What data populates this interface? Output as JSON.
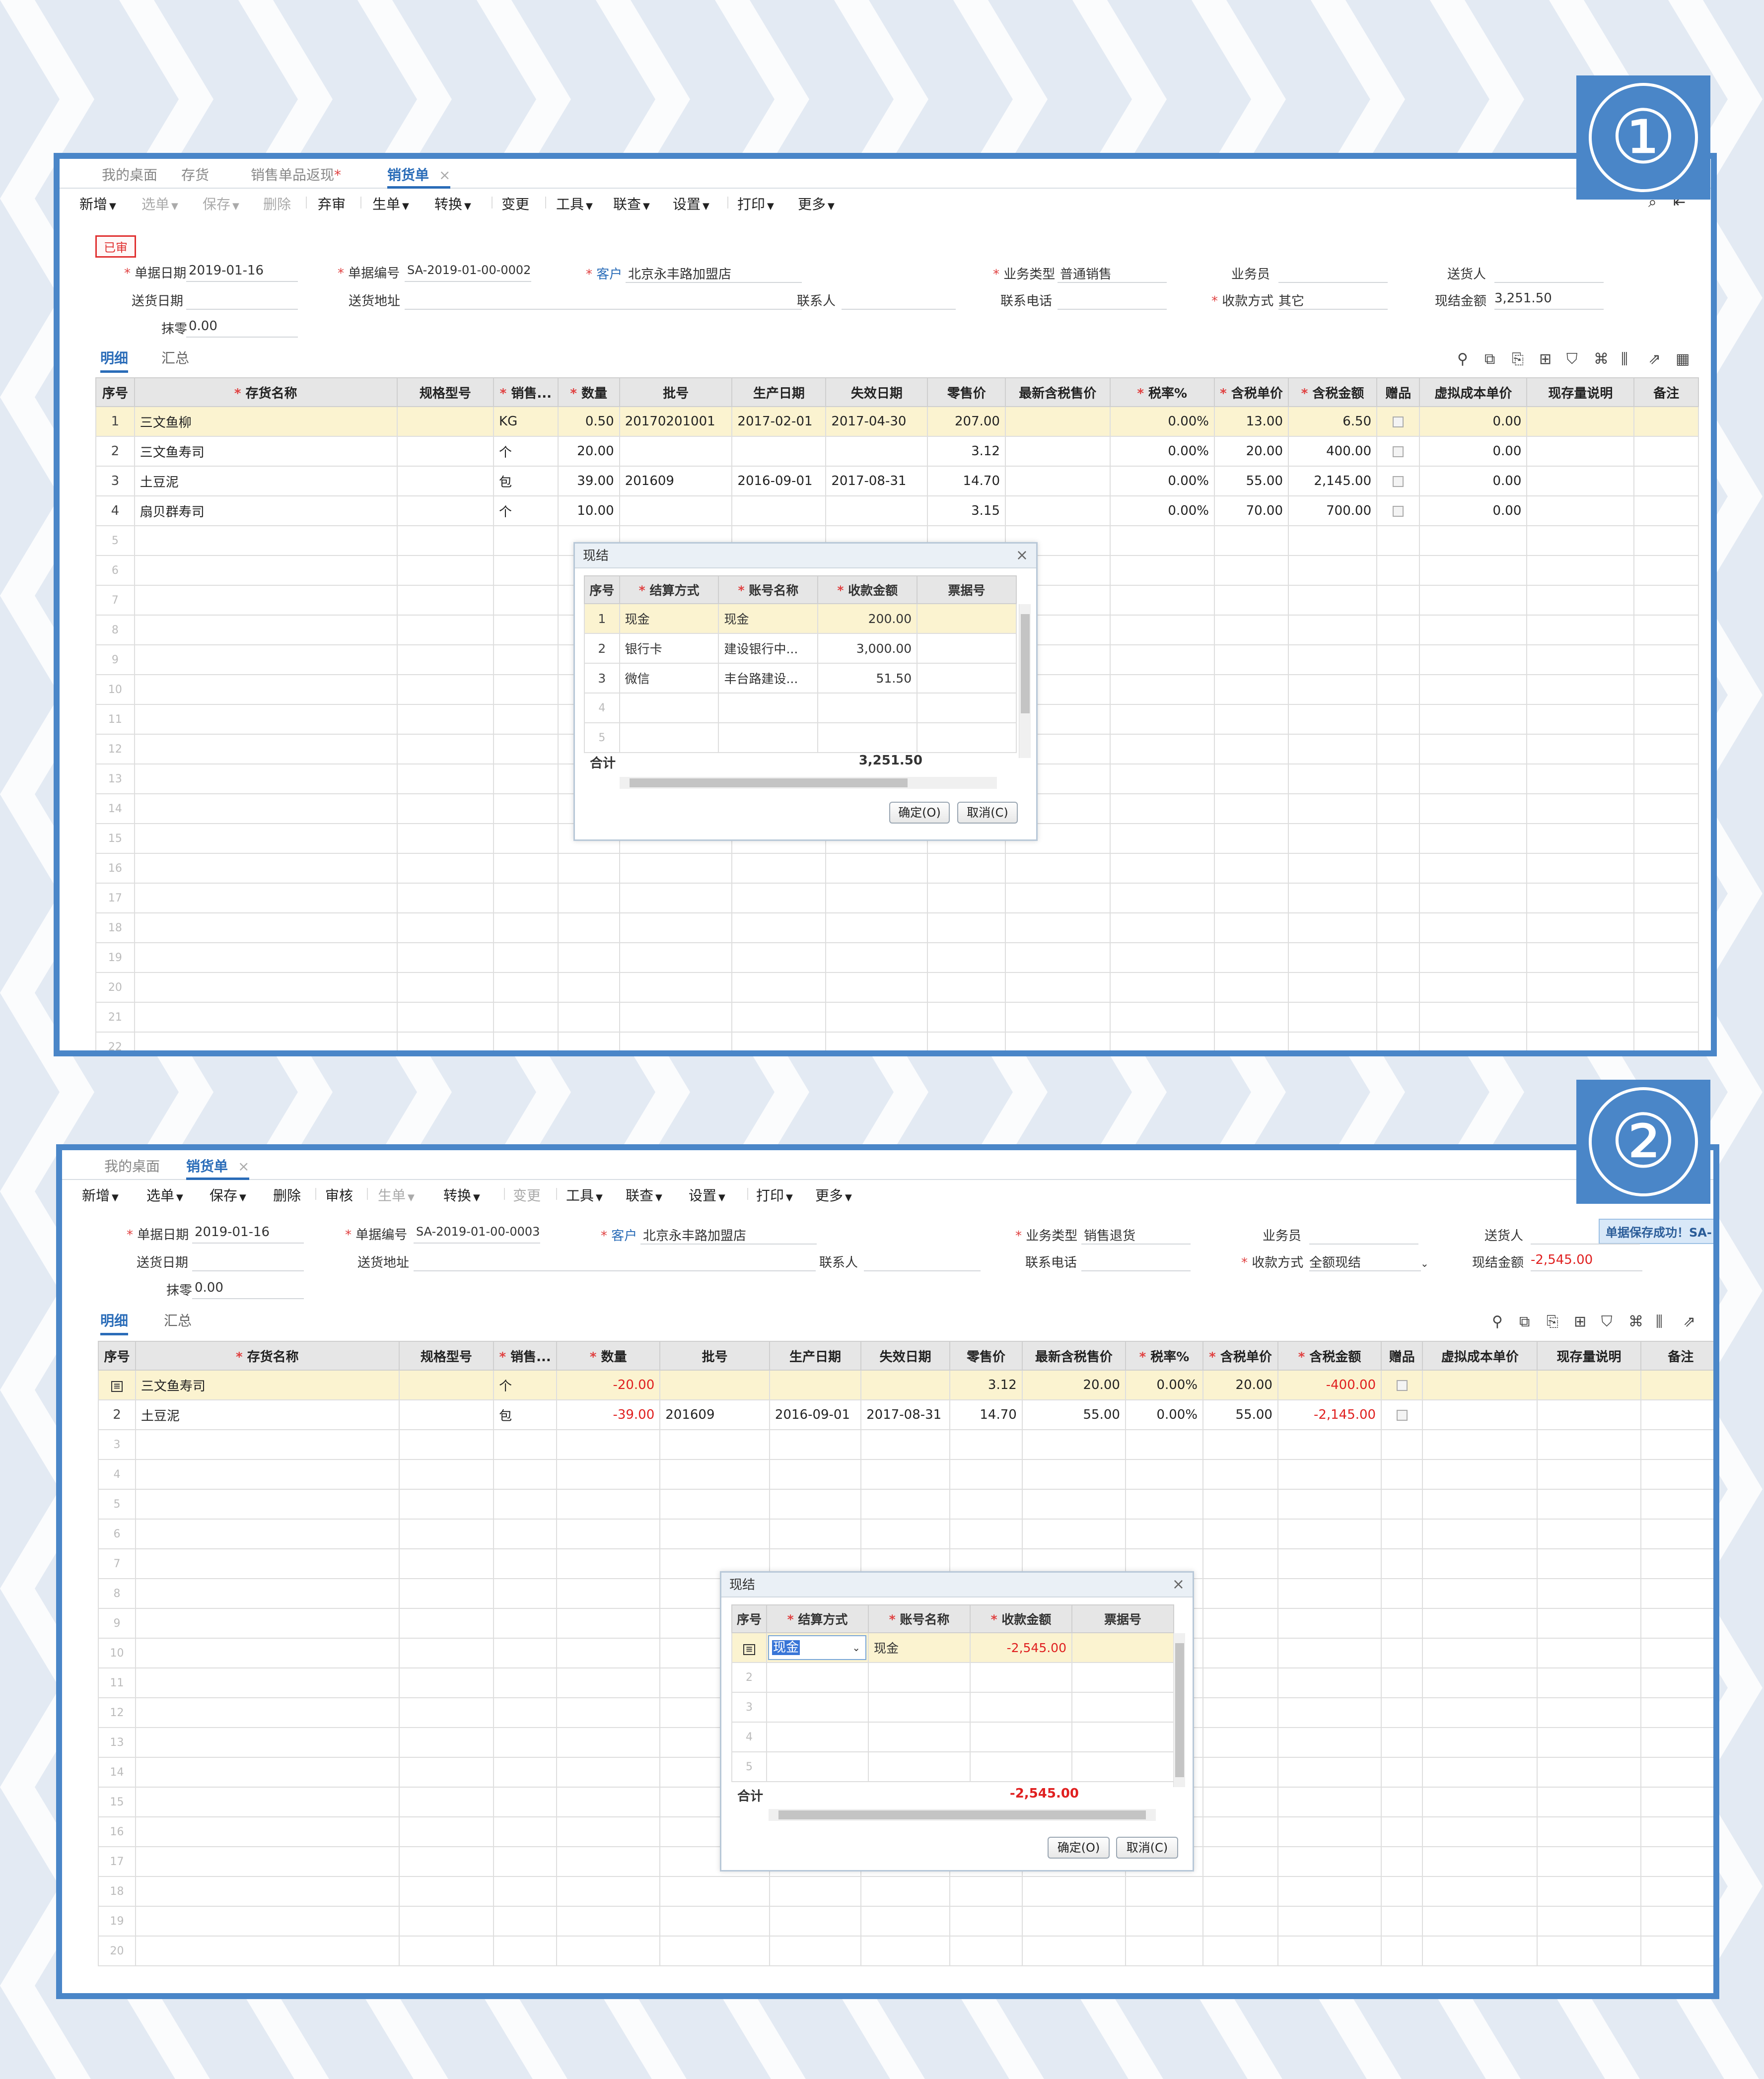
{
  "badges": {
    "one": "①",
    "two": "②"
  },
  "panel1": {
    "tabs": [
      {
        "label": "我的桌面"
      },
      {
        "label": "存货"
      },
      {
        "label": "销售单品返现",
        "star": "*"
      },
      {
        "label": "销货单",
        "close": "×"
      }
    ],
    "toolbar": [
      "新增",
      "选单",
      "保存",
      "删除",
      "弃审",
      "生单",
      "转换",
      "变更",
      "工具",
      "联查",
      "设置",
      "打印",
      "更多"
    ],
    "status_stamp": "已审",
    "header": {
      "doc_date_label": "单据日期",
      "doc_date": "2019-01-16",
      "doc_no_label": "单据编号",
      "doc_no": "SA-2019-01-00-0002",
      "customer_label": "客户",
      "customer": "北京永丰路加盟店",
      "biz_type_label": "业务类型",
      "biz_type": "普通销售",
      "salesman_label": "业务员",
      "deliverer_label": "送货人",
      "delivery_date_label": "送货日期",
      "delivery_addr_label": "送货地址",
      "contact_label": "联系人",
      "phone_label": "联系电话",
      "pay_method_label": "收款方式",
      "pay_method": "其它",
      "cash_amount_label": "现结金额",
      "cash_amount": "3,251.50",
      "round_off_label": "抹零",
      "round_off": "0.00"
    },
    "subtabs": [
      "明细",
      "汇总"
    ],
    "columns": [
      "序号",
      "存货名称",
      "规格型号",
      "销售...",
      "数量",
      "批号",
      "生产日期",
      "失效日期",
      "零售价",
      "最新含税售价",
      "税率%",
      "含税单价",
      "含税金额",
      "赠品",
      "虚拟成本单价",
      "现存量说明",
      "备注"
    ],
    "rows": [
      {
        "no": "1",
        "name": "三文鱼柳",
        "unit": "KG",
        "qty": "0.50",
        "batch": "20170201001",
        "mfg": "2017-02-01",
        "exp": "2017-04-30",
        "retail": "207.00",
        "tax_rate": "0.00%",
        "unit_price": "13.00",
        "amount": "6.50",
        "cost": "0.00"
      },
      {
        "no": "2",
        "name": "三文鱼寿司",
        "unit": "个",
        "qty": "20.00",
        "batch": "",
        "mfg": "",
        "exp": "",
        "retail": "3.12",
        "tax_rate": "0.00%",
        "unit_price": "20.00",
        "amount": "400.00",
        "cost": "0.00"
      },
      {
        "no": "3",
        "name": "土豆泥",
        "unit": "包",
        "qty": "39.00",
        "batch": "201609",
        "mfg": "2016-09-01",
        "exp": "2017-08-31",
        "retail": "14.70",
        "tax_rate": "0.00%",
        "unit_price": "55.00",
        "amount": "2,145.00",
        "cost": "0.00"
      },
      {
        "no": "4",
        "name": "扇贝群寿司",
        "unit": "个",
        "qty": "10.00",
        "batch": "",
        "mfg": "",
        "exp": "",
        "retail": "3.15",
        "tax_rate": "0.00%",
        "unit_price": "70.00",
        "amount": "700.00",
        "cost": "0.00"
      }
    ],
    "empty_rows": [
      "5",
      "6",
      "7",
      "8",
      "9",
      "10",
      "11",
      "12",
      "13",
      "14",
      "15",
      "16",
      "17",
      "18",
      "19",
      "20",
      "21",
      "22"
    ],
    "dialog": {
      "title": "现结",
      "close": "×",
      "columns": [
        "序号",
        "结算方式",
        "账号名称",
        "收款金额",
        "票据号"
      ],
      "rows": [
        {
          "no": "1",
          "method": "现金",
          "account": "现金",
          "amount": "200.00"
        },
        {
          "no": "2",
          "method": "银行卡",
          "account": "建设银行中...",
          "amount": "3,000.00"
        },
        {
          "no": "3",
          "method": "微信",
          "account": "丰台路建设...",
          "amount": "51.50"
        }
      ],
      "empty_rows": [
        "4",
        "5"
      ],
      "total_label": "合计",
      "total": "3,251.50",
      "ok": "确定(O)",
      "cancel": "取消(C)"
    }
  },
  "panel2": {
    "tabs": [
      {
        "label": "我的桌面"
      },
      {
        "label": "销货单",
        "close": "×"
      }
    ],
    "toolbar": [
      "新增",
      "选单",
      "保存",
      "删除",
      "审核",
      "生单",
      "转换",
      "变更",
      "工具",
      "联查",
      "设置",
      "打印",
      "更多"
    ],
    "success_msg": "单据保存成功！SA-",
    "header": {
      "doc_date_label": "单据日期",
      "doc_date": "2019-01-16",
      "doc_no_label": "单据编号",
      "doc_no": "SA-2019-01-00-0003",
      "customer_label": "客户",
      "customer": "北京永丰路加盟店",
      "biz_type_label": "业务类型",
      "biz_type": "销售退货",
      "salesman_label": "业务员",
      "deliverer_label": "送货人",
      "delivery_date_label": "送货日期",
      "delivery_addr_label": "送货地址",
      "contact_label": "联系人",
      "phone_label": "联系电话",
      "pay_method_label": "收款方式",
      "pay_method": "全额现结",
      "cash_amount_label": "现结金额",
      "cash_amount": "-2,545.00",
      "round_off_label": "抹零",
      "round_off": "0.00"
    },
    "subtabs": [
      "明细",
      "汇总"
    ],
    "columns": [
      "序号",
      "存货名称",
      "规格型号",
      "销售...",
      "数量",
      "批号",
      "生产日期",
      "失效日期",
      "零售价",
      "最新含税售价",
      "税率%",
      "含税单价",
      "含税金额",
      "赠品",
      "虚拟成本单价",
      "现存量说明",
      "备注"
    ],
    "rows": [
      {
        "no": "",
        "name": "三文鱼寿司",
        "unit": "个",
        "qty": "-20.00",
        "batch": "",
        "mfg": "",
        "exp": "",
        "retail": "3.12",
        "latest": "20.00",
        "tax_rate": "0.00%",
        "unit_price": "20.00",
        "amount": "-400.00"
      },
      {
        "no": "2",
        "name": "土豆泥",
        "unit": "包",
        "qty": "-39.00",
        "batch": "201609",
        "mfg": "2016-09-01",
        "exp": "2017-08-31",
        "retail": "14.70",
        "latest": "55.00",
        "tax_rate": "0.00%",
        "unit_price": "55.00",
        "amount": "-2,145.00"
      }
    ],
    "empty_rows": [
      "3",
      "4",
      "5",
      "6",
      "7",
      "8",
      "9",
      "10",
      "11",
      "12",
      "13",
      "14",
      "15",
      "16",
      "17",
      "18",
      "19",
      "20"
    ],
    "dialog": {
      "title": "现结",
      "close": "×",
      "columns": [
        "序号",
        "结算方式",
        "账号名称",
        "收款金额",
        "票据号"
      ],
      "rows": [
        {
          "no": "",
          "method": "现金",
          "account": "现金",
          "amount": "-2,545.00"
        }
      ],
      "empty_rows": [
        "2",
        "3",
        "4",
        "5"
      ],
      "total_label": "合计",
      "total": "-2,545.00",
      "ok": "确定(O)",
      "cancel": "取消(C)"
    }
  }
}
